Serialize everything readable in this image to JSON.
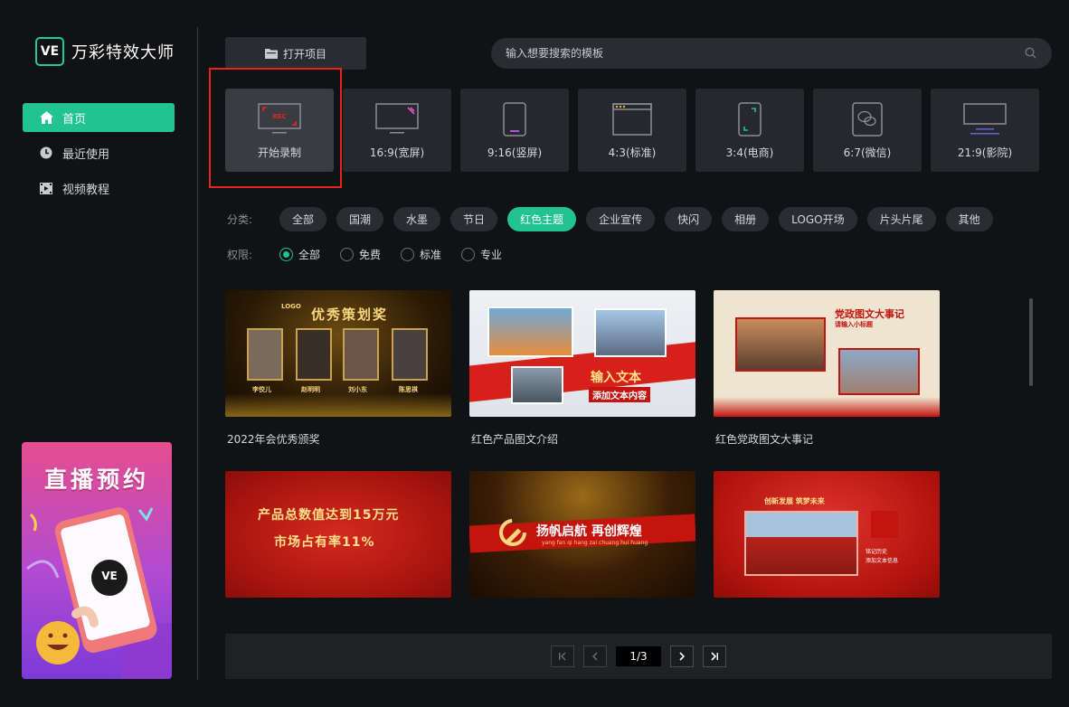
{
  "app": {
    "logo_mark": "VE",
    "title": "万彩特效大师"
  },
  "sidebar": {
    "items": [
      {
        "label": "首页",
        "icon": "home-icon",
        "active": true
      },
      {
        "label": "最近使用",
        "icon": "clock-icon",
        "active": false
      },
      {
        "label": "视频教程",
        "icon": "video-icon",
        "active": false
      }
    ],
    "promo": {
      "title": "直播预约",
      "phone_mark": "VE"
    }
  },
  "toolbar": {
    "open_project_label": "打开项目",
    "search_placeholder": "输入想要搜索的模板"
  },
  "ratios": [
    {
      "label": "开始录制",
      "icon": "rec-icon",
      "rec_text": "REC"
    },
    {
      "label": "16:9(宽屏)",
      "icon": "widescreen-icon"
    },
    {
      "label": "9:16(竖屏)",
      "icon": "portrait-icon"
    },
    {
      "label": "4:3(标准)",
      "icon": "standard-icon"
    },
    {
      "label": "3:4(电商)",
      "icon": "ecommerce-icon"
    },
    {
      "label": "6:7(微信)",
      "icon": "wechat-icon"
    },
    {
      "label": "21:9(影院)",
      "icon": "cinema-icon"
    }
  ],
  "filters": {
    "category_label": "分类:",
    "categories": [
      "全部",
      "国潮",
      "水墨",
      "节日",
      "红色主题",
      "企业宣传",
      "快闪",
      "相册",
      "LOGO开场",
      "片头片尾",
      "其他"
    ],
    "active_category": "红色主题",
    "permission_label": "权限:",
    "permissions": [
      "全部",
      "免费",
      "标准",
      "专业"
    ],
    "active_permission": "全部"
  },
  "templates": [
    {
      "caption": "2022年会优秀颁奖",
      "thumb_title": "优秀策划奖",
      "thumb_logo": "LOGO",
      "names": [
        "李佼儿",
        "赵明明",
        "刘小东",
        "陈思祺"
      ]
    },
    {
      "caption": "红色产品图文介绍",
      "thumb_title": "输入文本",
      "thumb_sub": "添加文本内容"
    },
    {
      "caption": "红色党政图文大事记",
      "thumb_title": "党政图文大事记",
      "thumb_sub": "请输入小标题"
    },
    {
      "caption": "",
      "thumb_line1": "产品总数值达到15万元",
      "thumb_line2": "市场占有率11%"
    },
    {
      "caption": "",
      "thumb_title": "扬帆启航 再创辉煌",
      "thumb_sub": "yang fan qi hang zai chuang hui huang"
    },
    {
      "caption": "",
      "thumb_title": "创新发展 筑梦未来",
      "thumb_sub1": "铭记历史",
      "thumb_sub2": "添加文本信息"
    }
  ],
  "pager": {
    "info": "1/3"
  },
  "colors": {
    "accent": "#21c391",
    "highlight": "#e5231f",
    "bg": "#111214"
  }
}
